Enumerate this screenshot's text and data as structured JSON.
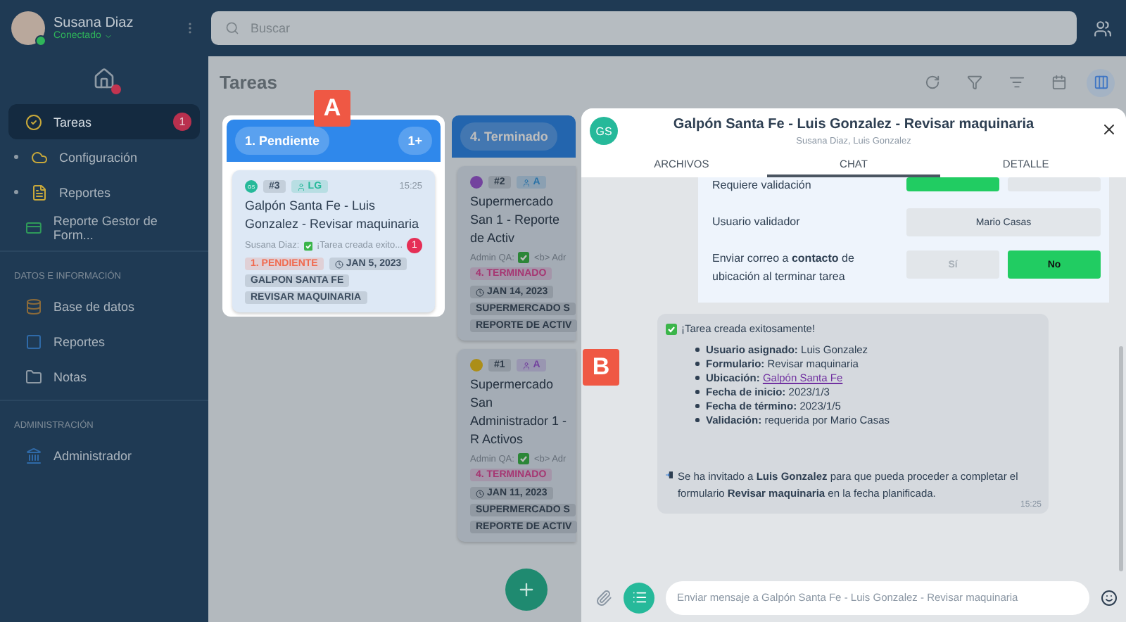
{
  "sidebar": {
    "user": {
      "name": "Susana Diaz",
      "status": "Conectado"
    },
    "items": [
      {
        "label": "Tareas",
        "selected": true,
        "badge": "1",
        "expandable": false
      },
      {
        "label": "Configuración",
        "selected": false,
        "expandable": true
      },
      {
        "label": "Reportes",
        "selected": false,
        "expandable": true
      },
      {
        "label": "Reporte Gestor de Form...",
        "selected": false,
        "expandable": false
      }
    ],
    "sections": [
      {
        "title": "DATOS E INFORMACIÓN",
        "items": [
          {
            "label": "Base de datos",
            "selected": false
          },
          {
            "label": "Reportes",
            "selected": false
          },
          {
            "label": "Notas",
            "selected": false
          }
        ]
      },
      {
        "title": "ADMINISTRACIÓN",
        "items": [
          {
            "label": "Administrador",
            "selected": false
          }
        ]
      }
    ]
  },
  "search": {
    "placeholder": "Buscar"
  },
  "page": {
    "title": "Tareas"
  },
  "toolbar": [
    {
      "selected": false
    },
    {
      "selected": false
    },
    {
      "selected": false
    },
    {
      "selected": false
    },
    {
      "selected": true
    }
  ],
  "columns": [
    {
      "title": "1. Pendiente",
      "count": "1+",
      "highlighted": true,
      "callout": "A",
      "cards": [
        {
          "avatar": "GS",
          "number": "#3",
          "assignee": "LG",
          "time": "15:25",
          "title": "Galpón Santa Fe - Luis Gonzalez - Revisar maquinaria",
          "author": "Susana Diaz:",
          "preview": "¡Tarea creada exito...",
          "unread": "1",
          "status": "1. PENDIENTE",
          "date": "JAN 5, 2023",
          "tags": [
            "GALPON SANTA FE",
            "REVISAR MAQUINARIA"
          ]
        }
      ]
    },
    {
      "title": "4. Terminado",
      "highlighted": false,
      "cards": [
        {
          "number": "#2",
          "assignee": "A",
          "title": "Supermercado San 1 - Reporte de Activ",
          "author": "Admin QA:",
          "preview": "<b> Adr",
          "status": "4. TERMINADO",
          "date": "JAN 14, 2023",
          "tags": [
            "SUPERMERCADO S",
            "REPORTE DE ACTIV"
          ]
        },
        {
          "number": "#1",
          "assignee": "A",
          "title": "Supermercado San Administrador 1 - R Activos",
          "author": "Admin QA:",
          "preview": "<b> Adr",
          "status": "4. TERMINADO",
          "date": "JAN 11, 2023",
          "tags": [
            "SUPERMERCADO S",
            "REPORTE DE ACTIV"
          ]
        }
      ]
    }
  ],
  "chat": {
    "callout": "B",
    "avatar": "GS",
    "title": "Galpón Santa Fe - Luis Gonzalez - Revisar maquinaria",
    "subtitle": "Susana Diaz, Luis Gonzalez",
    "tabs": [
      {
        "label": "ARCHIVOS",
        "selected": false
      },
      {
        "label": "CHAT",
        "selected": true
      },
      {
        "label": "DETALLE",
        "selected": false
      }
    ],
    "form": [
      {
        "kind": "toggle",
        "label": "Requiere validación",
        "options": [
          {
            "selected": true
          },
          {
            "selected": false
          }
        ]
      },
      {
        "kind": "value",
        "label": "Usuario validador",
        "value": "Mario Casas"
      },
      {
        "kind": "toggle",
        "label": "Enviar correo a **contacto** de ubicación al terminar tarea",
        "options": [
          {
            "label": "Sí",
            "selected": false
          },
          {
            "label": "No",
            "selected": true
          }
        ]
      }
    ],
    "message": {
      "heading": "¡Tarea creada exitosamente!",
      "items": [
        {
          "kind": "text",
          "text": "**Usuario asignado:** Luis Gonzalez"
        },
        {
          "kind": "text",
          "text": "**Formulario:**  Revisar maquinaria"
        },
        {
          "kind": "link",
          "label": "Ubicación:",
          "link": "Galpón Santa Fe"
        },
        {
          "kind": "text",
          "text": "**Fecha de inicio:** 2023/1/3"
        },
        {
          "kind": "text",
          "text": "**Fecha de término:** 2023/1/5"
        },
        {
          "kind": "text",
          "text": "**Validación:** requerida por Mario Casas"
        }
      ],
      "note": "Se ha invitado a **Luis Gonzalez** para que pueda proceder a completar el formulario  **Revisar maquinaria**  en la fecha planificada.",
      "time": "15:25"
    },
    "input": {
      "placeholder": "Enviar mensaje a Galpón Santa Fe - Luis Gonzalez - Revisar maquinaria"
    }
  }
}
